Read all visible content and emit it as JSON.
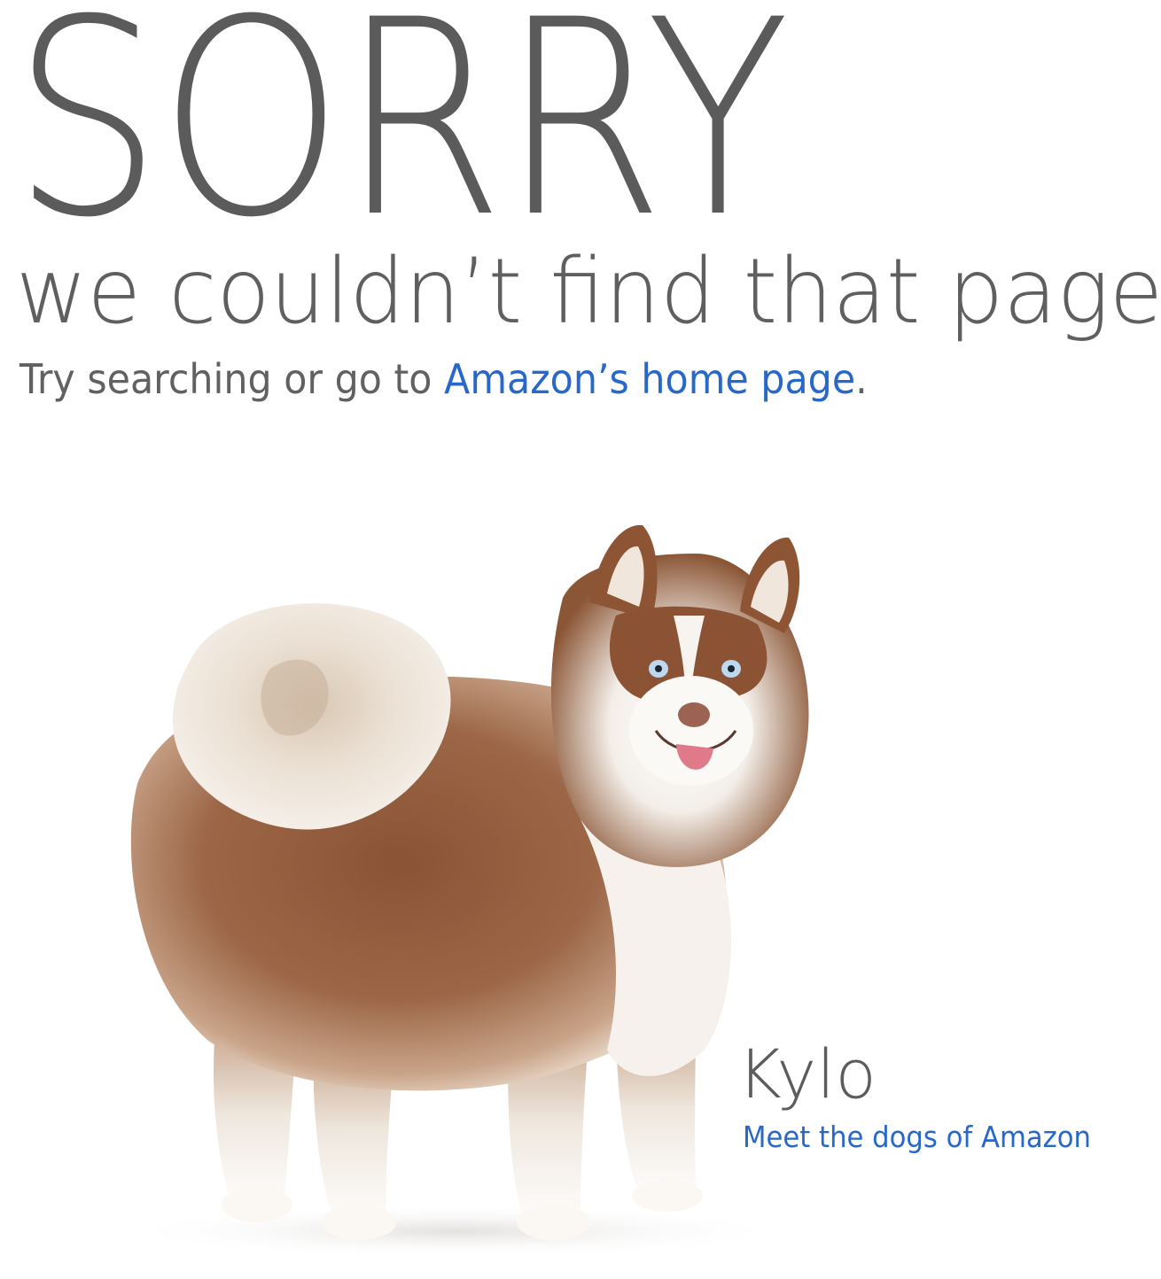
{
  "error_page": {
    "headline": "SORRY",
    "subheadline": "we couldn’t find that page",
    "help_prefix": "Try searching or go to ",
    "home_link_label": "Amazon’s home page",
    "help_suffix": "."
  },
  "featured_dog": {
    "name": "Kylo",
    "link_label": "Meet the dogs of Amazon"
  },
  "colors": {
    "text": "#5f5f5f",
    "link": "#2868c8",
    "background": "#ffffff"
  }
}
